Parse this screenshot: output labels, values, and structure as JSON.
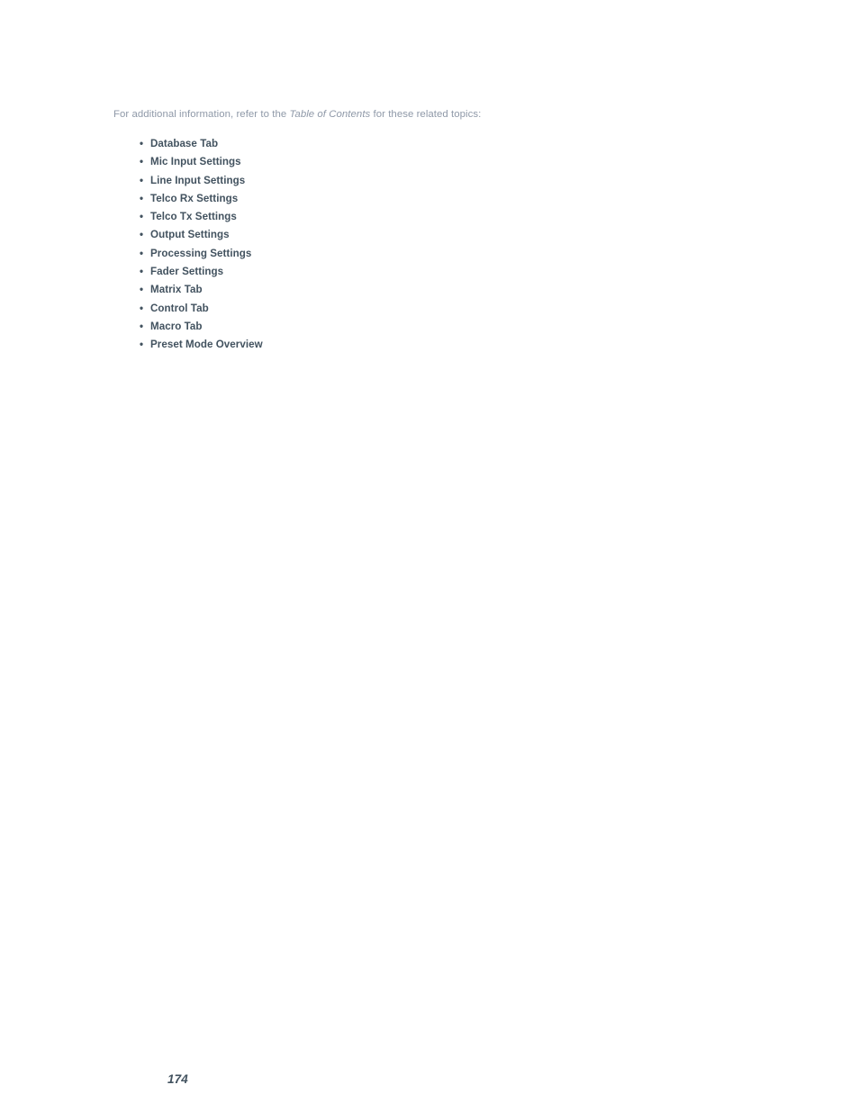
{
  "page": {
    "number": "174",
    "background_color": "#ffffff"
  },
  "intro": {
    "text_before": "For additional information, refer to the ",
    "emphasis": "Table of Contents",
    "text_after": " for these related topics:",
    "color": "#8f99a8"
  },
  "topic_list": {
    "bullet_glyph": "•",
    "color": "#42525f",
    "items": [
      {
        "label": "Database Tab"
      },
      {
        "label": "Mic Input Settings"
      },
      {
        "label": "Line Input Settings"
      },
      {
        "label": "Telco Rx Settings"
      },
      {
        "label": "Telco Tx Settings"
      },
      {
        "label": "Output Settings"
      },
      {
        "label": "Processing Settings"
      },
      {
        "label": "Fader Settings"
      },
      {
        "label": "Matrix Tab"
      },
      {
        "label": "Control Tab"
      },
      {
        "label": "Macro Tab"
      },
      {
        "label": "Preset Mode Overview"
      }
    ]
  }
}
